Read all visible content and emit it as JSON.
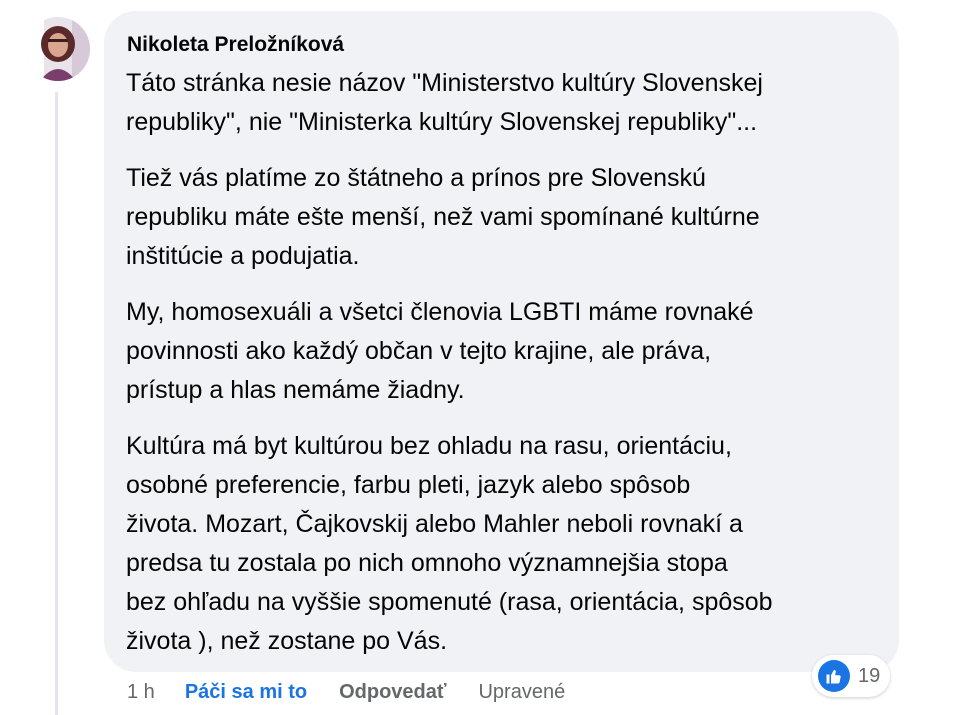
{
  "comment": {
    "author": "Nikoleta Preložníková",
    "paragraphs": [
      "Táto stránka nesie názov \"Ministerstvo kultúry Slovenskej\nrepubliky\", nie \"Ministerka kultúry Slovenskej republiky\"...",
      "Tiež vás platíme zo štátneho a prínos pre Slovenskú\nrepubliku máte ešte menší, než vami spomínané kultúrne\ninštitúcie a podujatia.",
      "My, homosexuáli a všetci členovia LGBTI máme rovnaké\npovinnosti ako každý občan v tejto krajine, ale práva,\nprístup a hlas nemáme žiadny.",
      "Kultúra má byt kultúrou bez ohladu na rasu, orientáciu,\nosobné preferencie, farbu pleti, jazyk alebo spôsob\nživota. Mozart, Čajkovskij alebo Mahler neboli rovnakí a\npredsa tu zostala po nich omnoho významnejšia stopa\nbez ohľadu na vyššie spomenuté (rasa, orientácia, spôsob\nživota ), než zostane po Vás."
    ]
  },
  "actions": {
    "time": "1 h",
    "like_label": "Páči sa mi to",
    "reply_label": "Odpovedať",
    "edited_label": "Upravené"
  },
  "reactions": {
    "icon": "like-thumb-icon",
    "count": "19"
  },
  "colors": {
    "bubble_bg": "#f0f2f5",
    "link_blue": "#1b74e4",
    "meta_gray": "#65676b",
    "text": "#050505"
  }
}
